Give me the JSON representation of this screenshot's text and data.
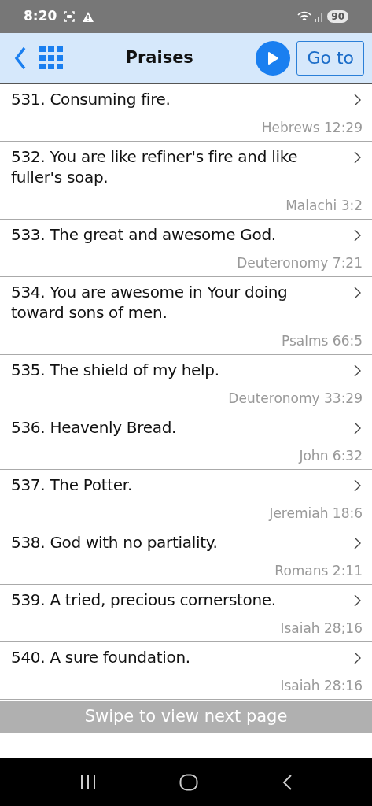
{
  "status_bar": {
    "time": "8:20",
    "battery": "90"
  },
  "header": {
    "title": "Praises",
    "goto_label": "Go to"
  },
  "items": [
    {
      "title": "531. Consuming fire.",
      "reference": "Hebrews 12:29"
    },
    {
      "title": "532. You are like refiner's fire and like fuller's soap.",
      "reference": "Malachi 3:2"
    },
    {
      "title": "533. The great and awesome God.",
      "reference": "Deuteronomy 7:21"
    },
    {
      "title": "534. You are awesome in Your doing toward sons of men.",
      "reference": "Psalms 66:5"
    },
    {
      "title": "535. The shield of my help.",
      "reference": "Deuteronomy 33:29"
    },
    {
      "title": "536. Heavenly Bread.",
      "reference": "John 6:32"
    },
    {
      "title": "537. The Potter.",
      "reference": "Jeremiah 18:6"
    },
    {
      "title": "538. God with no partiality.",
      "reference": "Romans 2:11"
    },
    {
      "title": "539. A tried, precious cornerstone.",
      "reference": "Isaiah 28;16"
    },
    {
      "title": "540. A sure foundation.",
      "reference": "Isaiah 28:16"
    }
  ],
  "footer_hint": "Swipe to view next page"
}
